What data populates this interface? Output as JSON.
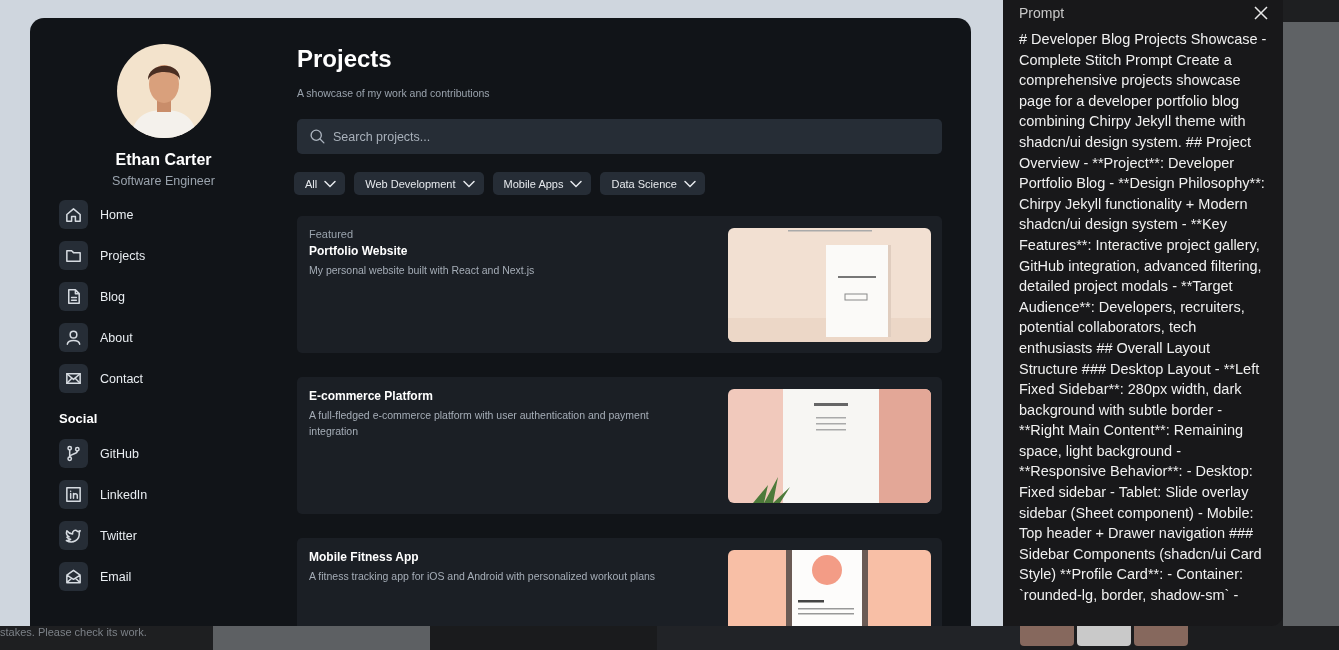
{
  "sidebar": {
    "profile": {
      "name": "Ethan Carter",
      "role": "Software Engineer"
    },
    "nav": [
      {
        "label": "Home",
        "kind": "home"
      },
      {
        "label": "Projects",
        "kind": "folder"
      },
      {
        "label": "Blog",
        "kind": "document"
      },
      {
        "label": "About",
        "kind": "user"
      },
      {
        "label": "Contact",
        "kind": "mail"
      }
    ],
    "social_heading": "Social",
    "social": [
      {
        "label": "GitHub",
        "kind": "branch"
      },
      {
        "label": "LinkedIn",
        "kind": "linkedin"
      },
      {
        "label": "Twitter",
        "kind": "bird"
      },
      {
        "label": "Email",
        "kind": "envelope"
      }
    ]
  },
  "main": {
    "title": "Projects",
    "subtitle": "A showcase of my work and contributions",
    "search": {
      "placeholder": "Search projects..."
    },
    "filters": [
      {
        "label": "All"
      },
      {
        "label": "Web Development"
      },
      {
        "label": "Mobile Apps"
      },
      {
        "label": "Data Science"
      }
    ],
    "projects": [
      {
        "badge": "Featured",
        "title": "Portfolio Website",
        "description": "My personal website built with React and Next.js"
      },
      {
        "title": "E-commerce Platform",
        "description": "A full-fledged e-commerce platform with user authentication and payment integration"
      },
      {
        "title": "Mobile Fitness App",
        "description": "A fitness tracking app for iOS and Android with personalized workout plans"
      }
    ]
  },
  "prompt_panel": {
    "title": "Prompt",
    "text": "# Developer Blog Projects Showcase - Complete Stitch Prompt Create a comprehensive projects showcase page for a developer portfolio blog combining Chirpy Jekyll theme with shadcn/ui design system. ## Project Overview - **Project**: Developer Portfolio Blog - **Design Philosophy**: Chirpy Jekyll functionality + Modern shadcn/ui design system - **Key Features**: Interactive project gallery, GitHub integration, advanced filtering, detailed project modals - **Target Audience**: Developers, recruiters, potential collaborators, tech enthusiasts ## Overall Layout Structure ### Desktop Layout - **Left Fixed Sidebar**: 280px width, dark background with subtle border - **Right Main Content**: Remaining space, light background - **Responsive Behavior**: - Desktop: Fixed sidebar - Tablet: Slide overlay sidebar (Sheet component) - Mobile: Top header + Drawer navigation ### Sidebar Components (shadcn/ui Card Style) **Profile Card**: - Container: `rounded-lg, border, shadow-sm` -"
  },
  "status_text": "stakes. Please check its work."
}
